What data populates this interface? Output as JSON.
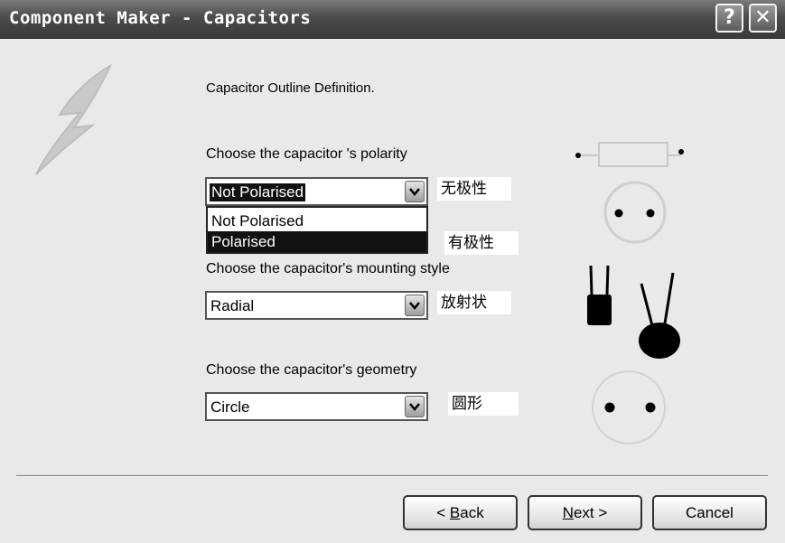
{
  "window": {
    "title": "Component Maker - Capacitors",
    "help_label": "?",
    "close_label": "✕"
  },
  "main": {
    "heading": "Capacitor Outline Definition.",
    "polarity": {
      "label": "Choose the capacitor 's polarity",
      "selected": "Not Polarised",
      "options": [
        "Not Polarised",
        "Polarised"
      ],
      "highlighted_option": "Polarised"
    },
    "mounting": {
      "label": "Choose the capacitor's mounting style",
      "selected": "Radial"
    },
    "geometry": {
      "label": "Choose the capacitor's geometry",
      "selected": "Circle"
    },
    "notes": [
      "无极性",
      "有极性",
      "放射状",
      "圆形"
    ]
  },
  "buttons": {
    "back": {
      "prefix": "< ",
      "accel": "B",
      "rest": "ack"
    },
    "next": {
      "prefix": "",
      "accel": "N",
      "rest": "ext >"
    },
    "cancel": "Cancel"
  },
  "icons": {
    "logo": "feather-logo-icon",
    "combo_arrow": "chevron-down-icon"
  }
}
